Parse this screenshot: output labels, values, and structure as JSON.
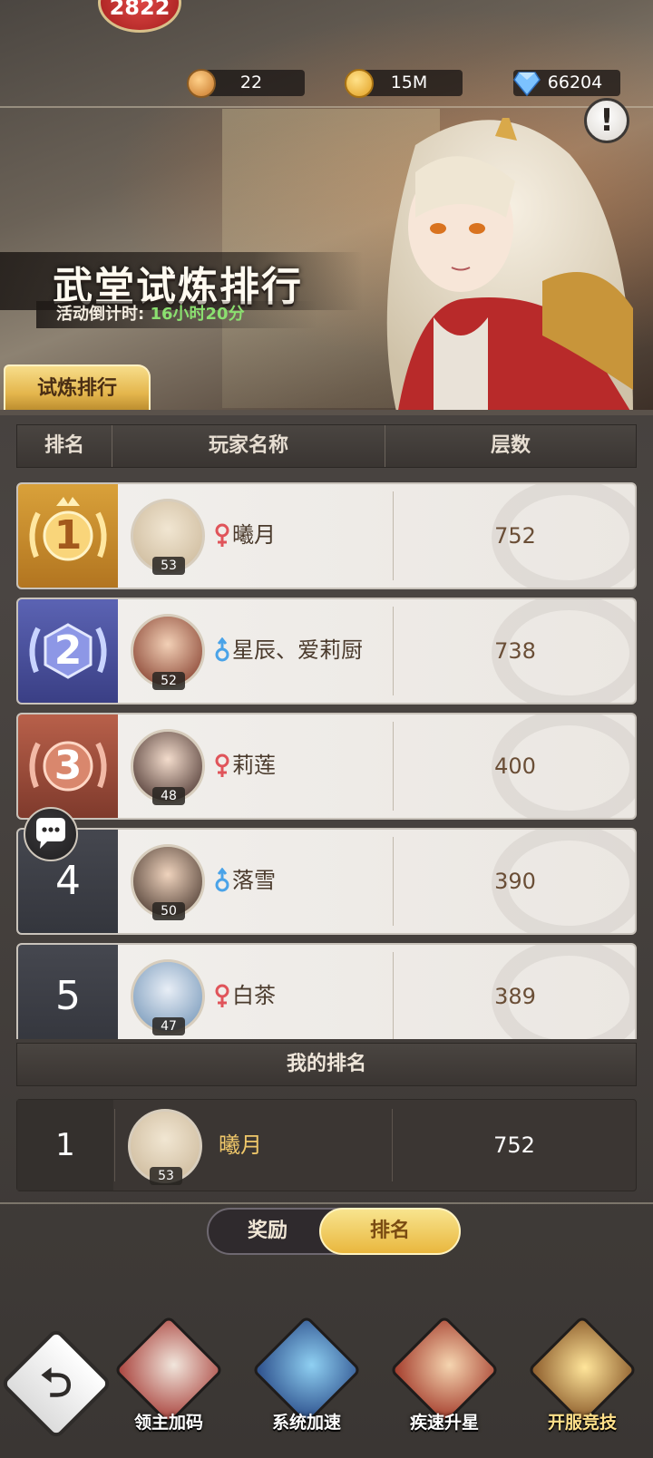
{
  "top": {
    "badge": "2822",
    "resources": {
      "tickets": "22",
      "gold": "15M",
      "diamonds": "66204"
    }
  },
  "banner": {
    "title": "武堂试炼排行",
    "countdown_label": "活动倒计时:",
    "countdown_value": "16小时20分",
    "tab": "试炼排行"
  },
  "table": {
    "headers": [
      "排名",
      "玩家名称",
      "层数"
    ],
    "rows": [
      {
        "rank": "1",
        "name": "曦月",
        "level": "53",
        "gender": "female",
        "score": "752"
      },
      {
        "rank": "2",
        "name": "星辰、爱莉厨",
        "level": "52",
        "gender": "male",
        "score": "738"
      },
      {
        "rank": "3",
        "name": "莉莲",
        "level": "48",
        "gender": "female",
        "score": "400"
      },
      {
        "rank": "4",
        "name": "落雪",
        "level": "50",
        "gender": "male",
        "score": "390"
      },
      {
        "rank": "5",
        "name": "白茶",
        "level": "47",
        "gender": "female",
        "score": "389"
      }
    ]
  },
  "my_rank": {
    "header": "我的排名",
    "rank": "1",
    "name": "曦月",
    "level": "53",
    "score": "752"
  },
  "toggle": {
    "reward": "奖励",
    "rank": "排名"
  },
  "bottom_nav": [
    {
      "label": "领主加码",
      "icon": "lord-bonus-icon"
    },
    {
      "label": "系统加速",
      "icon": "system-speedup-icon"
    },
    {
      "label": "疾速升星",
      "icon": "star-up-icon"
    },
    {
      "label": "开服竞技",
      "icon": "server-arena-icon"
    }
  ],
  "colors": {
    "gold_accent": "#e9b73e",
    "countdown_green": "#8be070",
    "female": "#e0545a",
    "male": "#4aa3e8"
  }
}
